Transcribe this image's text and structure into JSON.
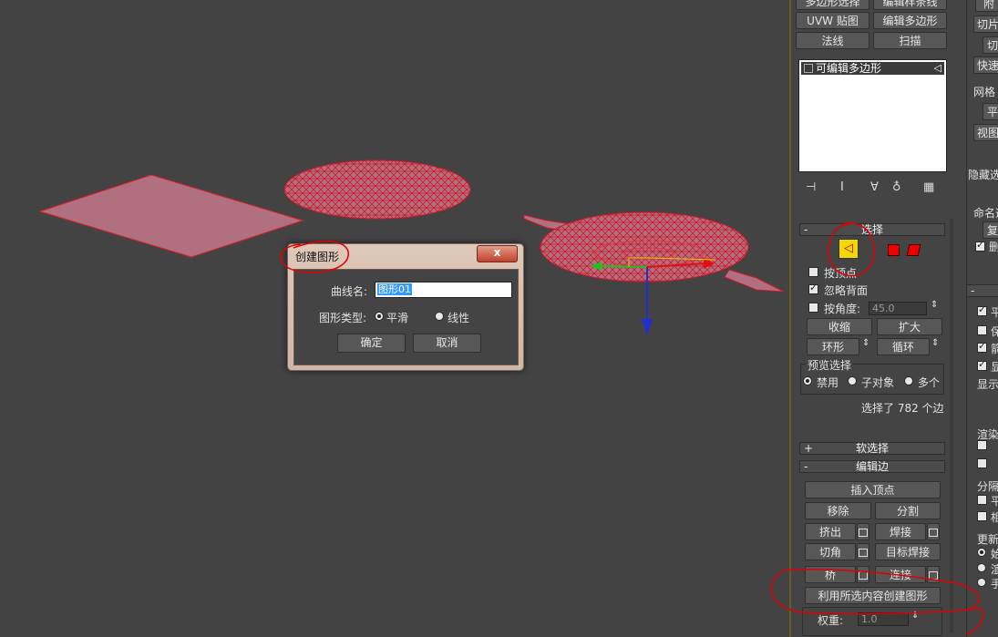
{
  "top_buttons": {
    "poly_select": "多边形选择",
    "edit_spline": "编辑样条线",
    "uvw_map": "UVW 贴图",
    "edit_poly": "编辑多边形",
    "normal": "法线",
    "sweep": "扫描"
  },
  "modifier_stack": {
    "item": "可编辑多边形"
  },
  "selection_rollout": {
    "title": "选择",
    "by_vertex": "按顶点",
    "ignore_backface": "忽略背面",
    "by_angle": "按角度:",
    "angle_value": "45.0",
    "shrink": "收缩",
    "grow": "扩大",
    "ring": "环形",
    "loop": "循环",
    "preview_title": "预览选择",
    "preview_off": "禁用",
    "preview_sub": "子对象",
    "preview_multi": "多个",
    "status": "选择了 782 个边"
  },
  "soft_selection": {
    "title": "软选择"
  },
  "edit_edges": {
    "title": "编辑边",
    "insert_vertex": "插入顶点",
    "remove": "移除",
    "split": "分割",
    "extrude": "挤出",
    "weld": "焊接",
    "chamfer": "切角",
    "target_weld": "目标焊接",
    "bridge": "桥",
    "connect": "连接",
    "create_shape": "利用所选内容创建图形",
    "weight_label": "权重:",
    "weight_value": "1.0"
  },
  "right_panel": {
    "items": [
      "附",
      "切片",
      "切",
      "快速",
      "网格",
      "平",
      "视图",
      "隐藏选",
      "命名选",
      "复",
      "删",
      "平",
      "保",
      "箭",
      "显",
      "显示",
      "渲染",
      "分隔",
      "平",
      "相",
      "更新",
      "始",
      "渲",
      "手"
    ]
  },
  "dialog": {
    "title": "创建图形",
    "close": "x",
    "curve_name_label": "曲线名:",
    "curve_name_value": "图形01",
    "shape_type_label": "图形类型:",
    "smooth": "平滑",
    "linear": "线性",
    "ok": "确定",
    "cancel": "取消"
  },
  "colors": {
    "viewport_bg": "#434343",
    "wire": "#cc1a2a",
    "fill": "#b07080",
    "accent_yellow": "#f5d800",
    "annotation": "#e00000"
  }
}
